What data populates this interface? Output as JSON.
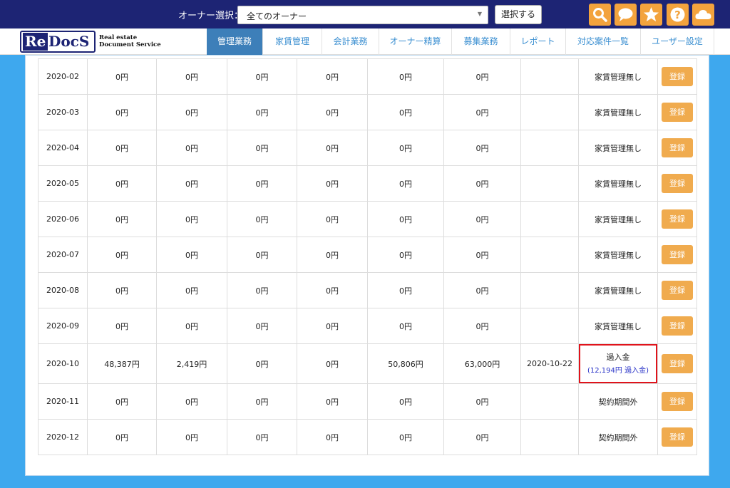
{
  "topbar": {
    "owner_label": "オーナー選択：",
    "owner_value": "全てのオーナー",
    "select_button": "選択する",
    "icons": [
      "search-icon",
      "chat-icon",
      "star-icon",
      "help-icon",
      "cloud-icon"
    ]
  },
  "logo": {
    "re": "Re",
    "docs": "DocS",
    "line1": "Real estate",
    "line2": "Document Service"
  },
  "nav": {
    "tabs": [
      {
        "label": "管理業務"
      },
      {
        "label": "家賃管理"
      },
      {
        "label": "会計業務"
      },
      {
        "label": "オーナー精算"
      },
      {
        "label": "募集業務"
      },
      {
        "label": "レポート"
      },
      {
        "label": "対応案件一覧"
      },
      {
        "label": "ユーザー設定"
      }
    ]
  },
  "table": {
    "register_label": "登録",
    "rows": [
      {
        "month": "2020-02",
        "c1": "0円",
        "c2": "0円",
        "c3": "0円",
        "c4": "0円",
        "c5": "0円",
        "c6": "0円",
        "date": "",
        "status": "家賃管理無し"
      },
      {
        "month": "2020-03",
        "c1": "0円",
        "c2": "0円",
        "c3": "0円",
        "c4": "0円",
        "c5": "0円",
        "c6": "0円",
        "date": "",
        "status": "家賃管理無し"
      },
      {
        "month": "2020-04",
        "c1": "0円",
        "c2": "0円",
        "c3": "0円",
        "c4": "0円",
        "c5": "0円",
        "c6": "0円",
        "date": "",
        "status": "家賃管理無し"
      },
      {
        "month": "2020-05",
        "c1": "0円",
        "c2": "0円",
        "c3": "0円",
        "c4": "0円",
        "c5": "0円",
        "c6": "0円",
        "date": "",
        "status": "家賃管理無し"
      },
      {
        "month": "2020-06",
        "c1": "0円",
        "c2": "0円",
        "c3": "0円",
        "c4": "0円",
        "c5": "0円",
        "c6": "0円",
        "date": "",
        "status": "家賃管理無し"
      },
      {
        "month": "2020-07",
        "c1": "0円",
        "c2": "0円",
        "c3": "0円",
        "c4": "0円",
        "c5": "0円",
        "c6": "0円",
        "date": "",
        "status": "家賃管理無し"
      },
      {
        "month": "2020-08",
        "c1": "0円",
        "c2": "0円",
        "c3": "0円",
        "c4": "0円",
        "c5": "0円",
        "c6": "0円",
        "date": "",
        "status": "家賃管理無し"
      },
      {
        "month": "2020-09",
        "c1": "0円",
        "c2": "0円",
        "c3": "0円",
        "c4": "0円",
        "c5": "0円",
        "c6": "0円",
        "date": "",
        "status": "家賃管理無し"
      },
      {
        "month": "2020-10",
        "c1": "48,387円",
        "c2": "2,419円",
        "c3": "0円",
        "c4": "0円",
        "c5": "50,806円",
        "c6": "63,000円",
        "date": "2020-10-22",
        "status": "過入金",
        "status_sub": "(12,194円 過入金)",
        "highlight": true
      },
      {
        "month": "2020-11",
        "c1": "0円",
        "c2": "0円",
        "c3": "0円",
        "c4": "0円",
        "c5": "0円",
        "c6": "0円",
        "date": "",
        "status": "契約期間外"
      },
      {
        "month": "2020-12",
        "c1": "0円",
        "c2": "0円",
        "c3": "0円",
        "c4": "0円",
        "c5": "0円",
        "c6": "0円",
        "date": "",
        "status": "契約期間外"
      }
    ]
  },
  "colors": {
    "topbar": "#1d2474",
    "page_bg": "#3ea8ee",
    "accent_button": "#f0ab4e",
    "active_tab": "#3d7fb9",
    "highlight_border": "#e0131b"
  }
}
